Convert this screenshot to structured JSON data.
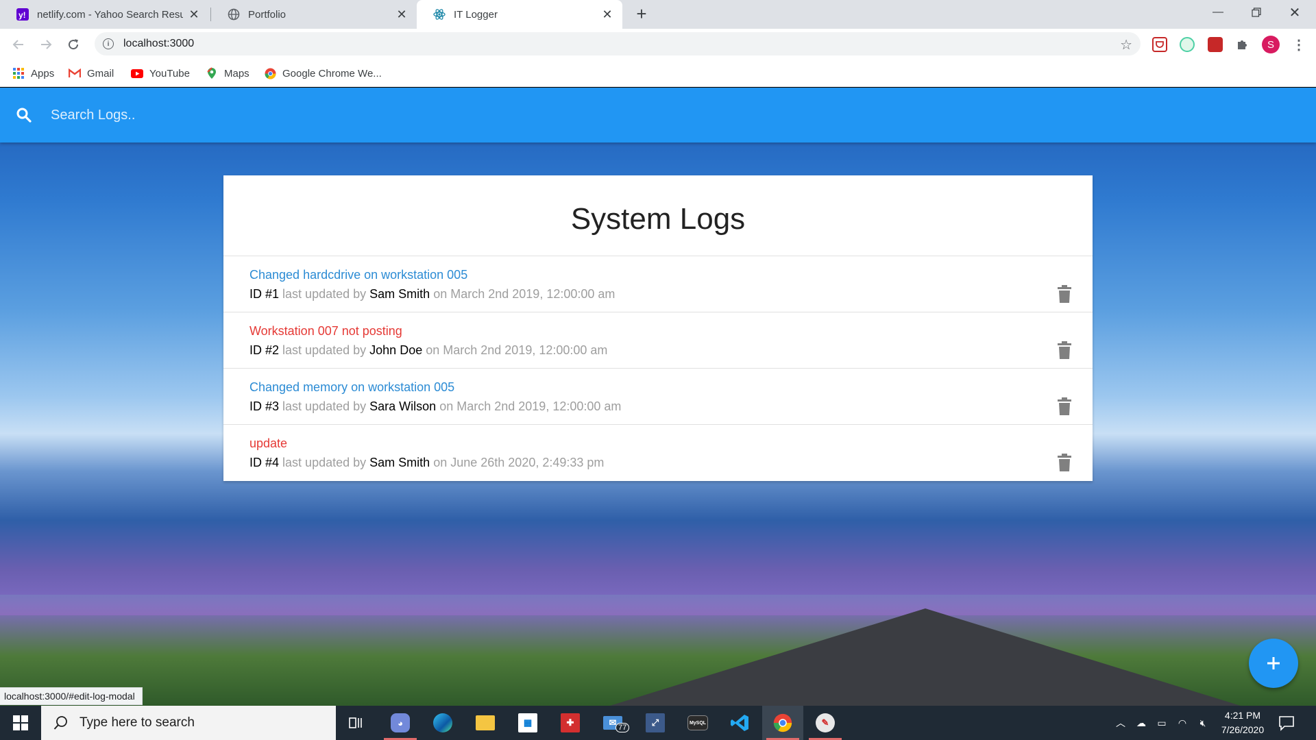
{
  "browser": {
    "tabs": [
      {
        "title": "netlify.com - Yahoo Search Resul",
        "favicon": "yahoo-favicon"
      },
      {
        "title": "Portfolio",
        "favicon": "globe-icon"
      },
      {
        "title": "IT Logger",
        "favicon": "react-favicon",
        "active": true
      }
    ],
    "url": "localhost:3000",
    "bookmarks": [
      {
        "label": "Apps",
        "icon": "apps-grid-icon"
      },
      {
        "label": "Gmail",
        "icon": "gmail-icon"
      },
      {
        "label": "YouTube",
        "icon": "youtube-icon"
      },
      {
        "label": "Maps",
        "icon": "maps-icon"
      },
      {
        "label": "Google Chrome We...",
        "icon": "chrome-icon"
      }
    ],
    "profile_initial": "S",
    "status_url": "localhost:3000/#edit-log-modal"
  },
  "app": {
    "search": {
      "placeholder": "Search Logs.."
    },
    "title": "System Logs",
    "logs": [
      {
        "message": "Changed hardcdrive on workstation 005",
        "attention": false,
        "id_text": "ID #1",
        "mid": "last updated by",
        "tech": "Sam Smith",
        "date_text": "on March 2nd 2019, 12:00:00 am"
      },
      {
        "message": "Workstation 007 not posting",
        "attention": true,
        "id_text": "ID #2",
        "mid": "last updated by",
        "tech": "John Doe",
        "date_text": "on March 2nd 2019, 12:00:00 am"
      },
      {
        "message": "Changed memory on workstation 005",
        "attention": false,
        "id_text": "ID #3",
        "mid": "last updated by",
        "tech": "Sara Wilson",
        "date_text": "on March 2nd 2019, 12:00:00 am"
      },
      {
        "message": "update",
        "attention": true,
        "id_text": "ID #4",
        "mid": "last updated by",
        "tech": "Sam Smith",
        "date_text": "on June 26th 2020, 2:49:33 pm"
      }
    ],
    "fab_icon": "add-icon",
    "colors": {
      "primary": "#2196f3",
      "message_normal": "#2b8bd4",
      "message_attention": "#e53935"
    }
  },
  "taskbar": {
    "search_placeholder": "Type here to search",
    "mail_badge": "77",
    "mysql_label": "MySQL",
    "time": "4:21 PM",
    "date": "7/26/2020"
  }
}
